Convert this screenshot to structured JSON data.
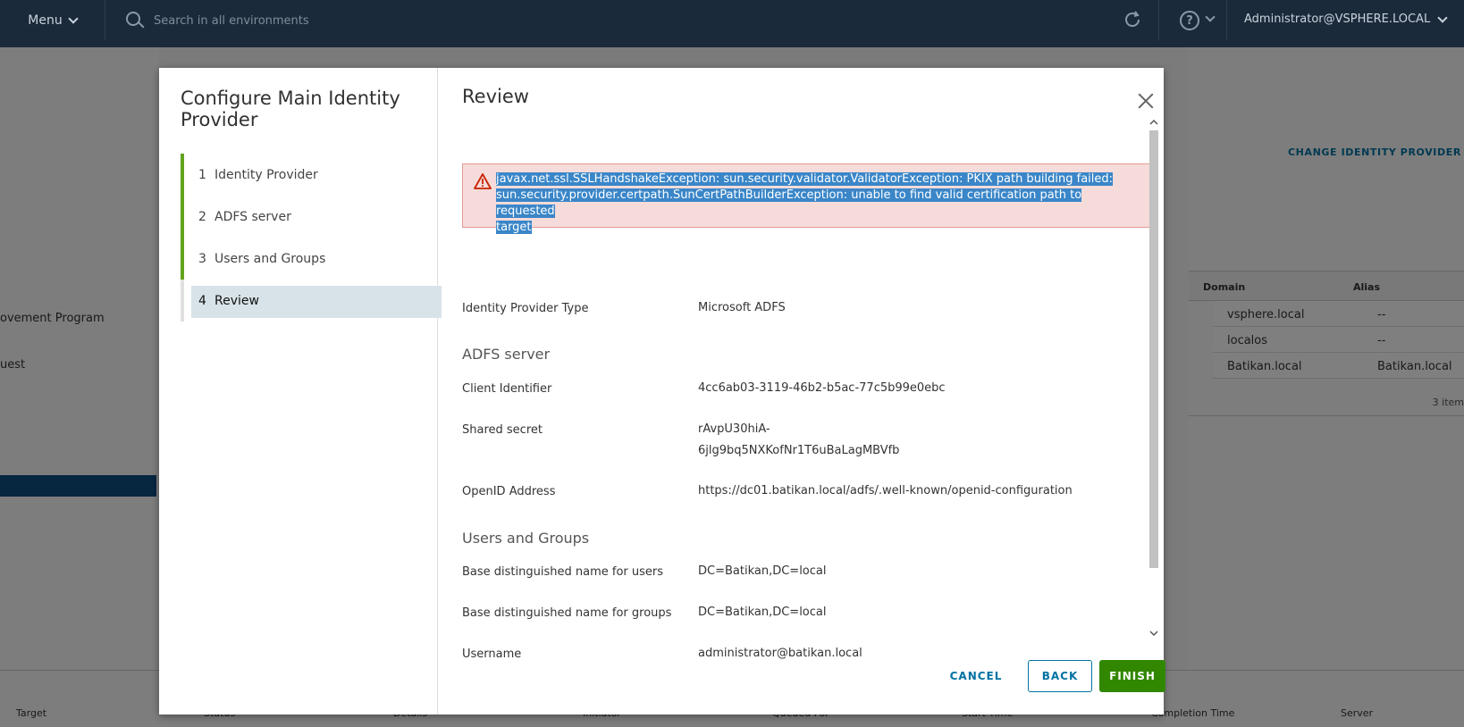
{
  "header": {
    "menu_label": "Menu",
    "search_placeholder": "Search in all environments",
    "user": "Administrator@VSPHERE.LOCAL"
  },
  "background": {
    "left_items": [
      "ovement Program",
      "uest"
    ],
    "link": "CHANGE IDENTITY PROVIDER",
    "table": {
      "headers": [
        "Domain",
        "Alias"
      ],
      "rows": [
        [
          "vsphere.local",
          "--"
        ],
        [
          "localos",
          "--"
        ],
        [
          "Batikan.local",
          "Batikan.local"
        ]
      ],
      "footer": "3 item"
    },
    "bottom_columns": [
      "Target",
      "Status",
      "Details",
      "Initiator",
      "Queued For",
      "Start Time",
      "Completion Time",
      "Server"
    ]
  },
  "wizard": {
    "title": "Configure Main Identity Provider",
    "steps": [
      {
        "num": "1",
        "label": "Identity Provider"
      },
      {
        "num": "2",
        "label": "ADFS server"
      },
      {
        "num": "3",
        "label": "Users and Groups"
      },
      {
        "num": "4",
        "label": "Review"
      }
    ],
    "active_step": 4
  },
  "review": {
    "title": "Review",
    "error": {
      "line1": "javax.net.ssl.SSLHandshakeException: sun.security.validator.ValidatorException: PKIX path building failed:",
      "line2": "sun.security.provider.certpath.SunCertPathBuilderException: unable to find valid certification path to requested",
      "line3": "target"
    },
    "identity_provider_type_label": "Identity Provider Type",
    "identity_provider_type": "Microsoft ADFS",
    "adfs_section": "ADFS server",
    "client_identifier_label": "Client Identifier",
    "client_identifier": "4cc6ab03-3119-46b2-b5ac-77c5b99e0ebc",
    "shared_secret_label": "Shared secret",
    "shared_secret_line1": "rAvpU30hiA-",
    "shared_secret_line2": "6jlg9bq5NXKofNr1T6uBaLagMBVfb",
    "openid_label": "OpenID Address",
    "openid": "https://dc01.batikan.local/adfs/.well-known/openid-configuration",
    "users_groups_section": "Users and Groups",
    "base_dn_users_label": "Base distinguished name for users",
    "base_dn_users": "DC=Batikan,DC=local",
    "base_dn_groups_label": "Base distinguished name for groups",
    "base_dn_groups": "DC=Batikan,DC=local",
    "username_label": "Username",
    "username": "administrator@batikan.local"
  },
  "buttons": {
    "cancel": "CANCEL",
    "back": "BACK",
    "finish": "FINISH"
  },
  "colors": {
    "header_bg": "#1b2a3a",
    "step_accent": "#62a420",
    "finish_green": "#318700",
    "link_blue": "#0072a3",
    "alert_bg": "#f5dbd9"
  }
}
